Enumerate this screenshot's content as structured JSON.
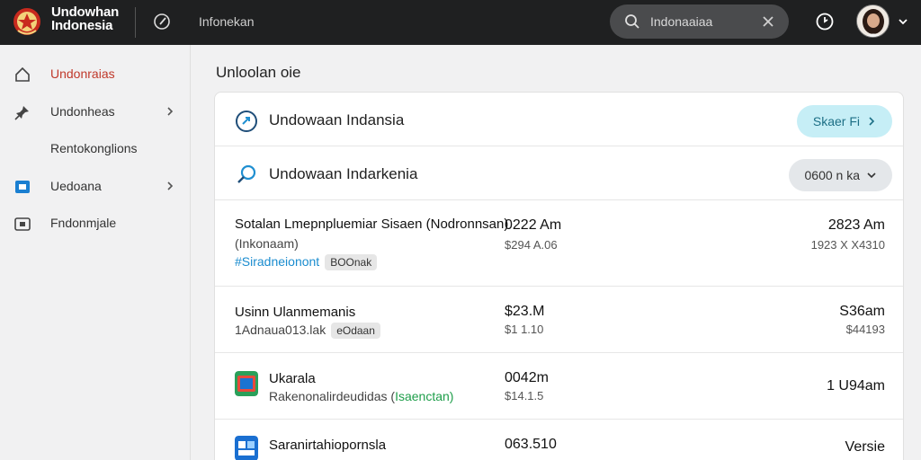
{
  "header": {
    "brand_line1": "Undowhan",
    "brand_line2": "Indonesia",
    "nav_link": "Infonekan",
    "search_value": "Indonaaiaa"
  },
  "sidebar": {
    "items": [
      {
        "label": "Undonraias",
        "icon": "home-icon",
        "active": true
      },
      {
        "label": "Undonheas",
        "icon": "pin-icon",
        "chevron": true
      },
      {
        "label": "Rentokonglions",
        "icon": ""
      },
      {
        "label": "Uedoana",
        "icon": "square-icon",
        "chevron": true
      },
      {
        "label": "Fndonmjale",
        "icon": "camera-icon"
      }
    ]
  },
  "main": {
    "title": "Unloolan oie",
    "sections": [
      {
        "label": "Undowaan Indansia",
        "icon": "refresh-icon",
        "button": "Skaer Fi",
        "button_style": "cyan"
      },
      {
        "label": "Undowaan Indarkenia",
        "icon": "search-icon",
        "button": "0600 n ka",
        "button_style": "gray"
      }
    ],
    "rows": [
      {
        "name": "Sotalan Lmepnpluemiar Sisaen (Nodronnsan)",
        "sub": "(Inkonaam)",
        "tag_link": "#Siradneionont",
        "tag_chip": "BOOnak",
        "mid_value": "0222 Am",
        "mid_sub": "$294 A.06",
        "right_value": "2823 Am",
        "right_sub": "1923 X X4310"
      },
      {
        "name": "Usinn Ulanmemanis",
        "sub": "1Adnaua013.lak",
        "tag_chip": "eOdaan",
        "mid_value": "$23.M",
        "mid_sub": "$1 1.10",
        "right_value": "S36am",
        "right_sub": "$44193"
      },
      {
        "name": "Ukarala",
        "sub": "Rakenonalirdeudidas (",
        "sub_green": "Isaenctan)",
        "mid_value": "0042m",
        "mid_sub": "$14.1.5",
        "right_value": "1 U94am",
        "right_color": "gold",
        "icon": "app-icon-green"
      },
      {
        "name": "Saranirtahiopornsla",
        "mid_value": "063.510",
        "right_value": "Versie",
        "right_color": "red",
        "icon": "app-icon-blue"
      }
    ]
  },
  "colors": {
    "topbar": "#1f2021",
    "accent_red": "#c0392b",
    "pill_cyan": "#c6eef6",
    "link_blue": "#1a8ccf"
  }
}
